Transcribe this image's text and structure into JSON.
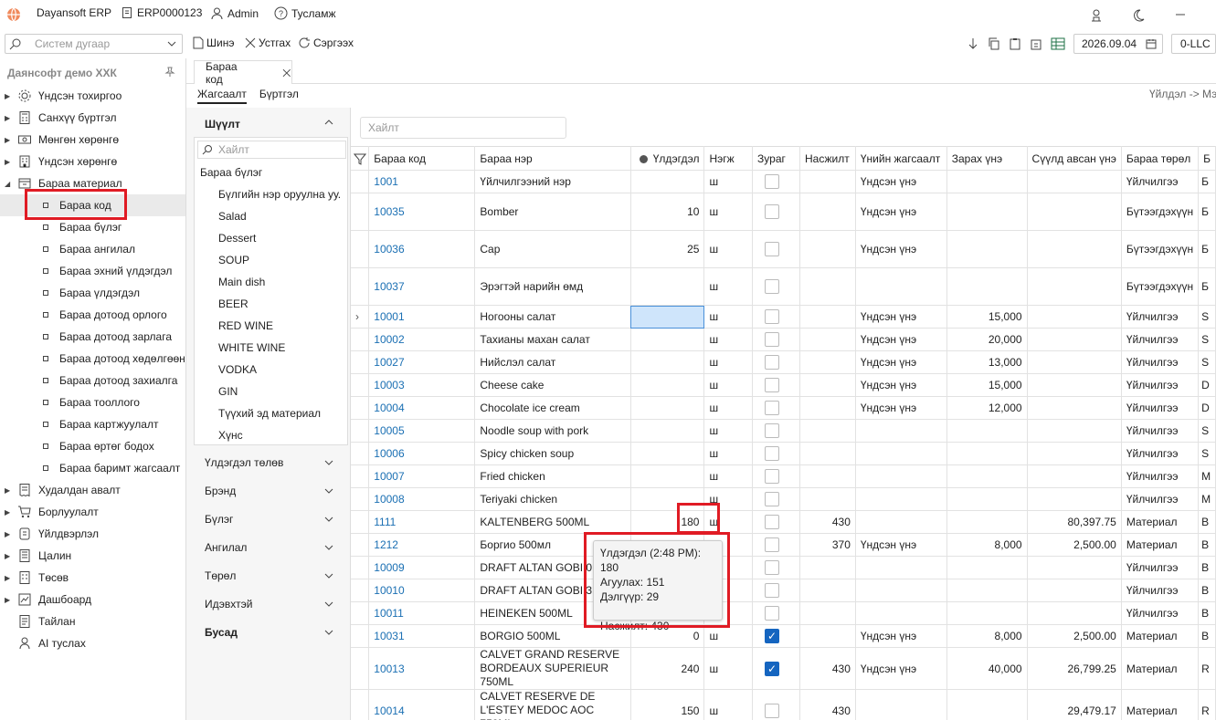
{
  "app": {
    "name": "Dayansoft ERP",
    "erp_code": "ERP0000123",
    "user": "Admin",
    "help": "Тусламж"
  },
  "toolbar": {
    "search_placeholder": "Систем дугаар",
    "new": "Шинэ",
    "delete": "Устгах",
    "refresh": "Сэргээх",
    "date": "2026.09.04",
    "org": "0-LLC"
  },
  "sidebar": {
    "company": "Даянсофт демо ХХК",
    "items": [
      {
        "label": "Үндсэн тохиргоо",
        "icon": "gear-icon"
      },
      {
        "label": "Санхүү бүртгэл",
        "icon": "calculator-icon"
      },
      {
        "label": "Мөнгөн хөрөнгө",
        "icon": "money-icon"
      },
      {
        "label": "Үндсэн хөрөнгө",
        "icon": "building-icon"
      },
      {
        "label": "Бараа материал",
        "icon": "box-icon"
      }
    ],
    "subitems": [
      "Бараа код",
      "Бараа бүлэг",
      "Бараа ангилал",
      "Бараа эхний үлдэгдэл",
      "Бараа үлдэгдэл",
      "Бараа дотоод орлого",
      "Бараа дотоод зарлага",
      "Бараа дотоод хөдөлгөөн",
      "Бараа дотоод захиалга",
      "Бараа тооллого",
      "Бараа картжуулалт",
      "Бараа өртөг бодох",
      "Бараа баримт жагсаалт"
    ],
    "items2": [
      {
        "label": "Худалдан авалт",
        "icon": "receipt-icon"
      },
      {
        "label": "Борлуулалт",
        "icon": "cart-icon"
      },
      {
        "label": "Үйлдвэрлэл",
        "icon": "factory-icon"
      },
      {
        "label": "Цалин",
        "icon": "payroll-icon"
      },
      {
        "label": "Төсөв",
        "icon": "budget-icon"
      },
      {
        "label": "Дашбоард",
        "icon": "dashboard-icon"
      },
      {
        "label": "Тайлан",
        "icon": "report-icon"
      },
      {
        "label": "AI туслах",
        "icon": "ai-assistant-icon"
      }
    ]
  },
  "tab": {
    "label": "Бараа код"
  },
  "subtabs": {
    "list": "Жагсаалт",
    "register": "Бүртгэл"
  },
  "breadcrumb": "Үйлдэл -> Мэ",
  "filter": {
    "title": "Шүүлт",
    "search_placeholder": "Хайлт",
    "group_header": "Бараа бүлэг",
    "groups": [
      "Бүлгийн нэр оруулна уу.",
      "Salad",
      "Dessert",
      "SOUP",
      "Main dish",
      "BEER",
      "RED WINE",
      "WHITE WINE",
      "VODKA",
      "GIN",
      "Түүхий эд материал",
      "Хүнс"
    ],
    "sections": [
      "Үлдэгдэл төлөв",
      "Брэнд",
      "Бүлэг",
      "Ангилал",
      "Төрөл",
      "Идэвхтэй",
      "Бусад"
    ]
  },
  "grid": {
    "search_placeholder": "Хайлт",
    "columns": [
      "Бараа код",
      "Бараа нэр",
      "Үлдэгдэл",
      "Нэгж",
      "Зураг",
      "Насжилт",
      "Үнийн жагсаалт",
      "Зарах үнэ",
      "Сүүлд авсан үнэ",
      "Бараа төрөл",
      "Б"
    ],
    "rows": [
      {
        "code": "1001",
        "name": "Үйлчилгээний нэр",
        "qty": "",
        "unit": "ш",
        "img": false,
        "age": "",
        "price_list": "Үндсэн үнэ",
        "sell": "",
        "last": "",
        "type": "Үйлчилгээ",
        "extra": "Б"
      },
      {
        "code": "10035",
        "name": "Bomber",
        "qty": "10",
        "unit": "ш",
        "img": false,
        "age": "",
        "price_list": "Үндсэн үнэ",
        "sell": "",
        "last": "",
        "type": "Бүтээгдэхүүн",
        "extra": "Б"
      },
      {
        "code": "10036",
        "name": "Cap",
        "qty": "25",
        "unit": "ш",
        "img": false,
        "age": "",
        "price_list": "Үндсэн үнэ",
        "sell": "",
        "last": "",
        "type": "Бүтээгдэхүүн",
        "extra": "Б"
      },
      {
        "code": "10037",
        "name": "Эрэгтэй нарийн өмд",
        "qty": "",
        "unit": "ш",
        "img": false,
        "age": "",
        "price_list": "",
        "sell": "",
        "last": "",
        "type": "Бүтээгдэхүүн",
        "extra": "Б"
      },
      {
        "code": "10001",
        "name": "Ногооны салат",
        "qty": "",
        "unit": "ш",
        "img": false,
        "age": "",
        "price_list": "Үндсэн үнэ",
        "sell": "15,000",
        "last": "",
        "type": "Үйлчилгээ",
        "extra": "S"
      },
      {
        "code": "10002",
        "name": "Тахианы махан салат",
        "qty": "",
        "unit": "ш",
        "img": false,
        "age": "",
        "price_list": "Үндсэн үнэ",
        "sell": "20,000",
        "last": "",
        "type": "Үйлчилгээ",
        "extra": "S"
      },
      {
        "code": "10027",
        "name": "Нийслэл салат",
        "qty": "",
        "unit": "ш",
        "img": false,
        "age": "",
        "price_list": "Үндсэн үнэ",
        "sell": "13,000",
        "last": "",
        "type": "Үйлчилгээ",
        "extra": "S"
      },
      {
        "code": "10003",
        "name": "Cheese cake",
        "qty": "",
        "unit": "ш",
        "img": false,
        "age": "",
        "price_list": "Үндсэн үнэ",
        "sell": "15,000",
        "last": "",
        "type": "Үйлчилгээ",
        "extra": "D"
      },
      {
        "code": "10004",
        "name": "Chocolate ice cream",
        "qty": "",
        "unit": "ш",
        "img": false,
        "age": "",
        "price_list": "Үндсэн үнэ",
        "sell": "12,000",
        "last": "",
        "type": "Үйлчилгээ",
        "extra": "D"
      },
      {
        "code": "10005",
        "name": "Noodle soup with pork",
        "qty": "",
        "unit": "ш",
        "img": false,
        "age": "",
        "price_list": "",
        "sell": "",
        "last": "",
        "type": "Үйлчилгээ",
        "extra": "S"
      },
      {
        "code": "10006",
        "name": "Spicy chicken soup",
        "qty": "",
        "unit": "ш",
        "img": false,
        "age": "",
        "price_list": "",
        "sell": "",
        "last": "",
        "type": "Үйлчилгээ",
        "extra": "S"
      },
      {
        "code": "10007",
        "name": "Fried chicken",
        "qty": "",
        "unit": "ш",
        "img": false,
        "age": "",
        "price_list": "",
        "sell": "",
        "last": "",
        "type": "Үйлчилгээ",
        "extra": "M"
      },
      {
        "code": "10008",
        "name": "Teriyaki chicken",
        "qty": "",
        "unit": "ш",
        "img": false,
        "age": "",
        "price_list": "",
        "sell": "",
        "last": "",
        "type": "Үйлчилгээ",
        "extra": "M"
      },
      {
        "code": "1111",
        "name": "KALTENBERG 500ML",
        "qty": "180",
        "unit": "ш",
        "img": false,
        "age": "430",
        "price_list": "",
        "sell": "",
        "last": "80,397.75",
        "type": "Материал",
        "extra": "B"
      },
      {
        "code": "1212",
        "name": "Боргио 500мл",
        "qty": "",
        "unit": "ш",
        "img": false,
        "age": "370",
        "price_list": "Үндсэн үнэ",
        "sell": "8,000",
        "last": "2,500.00",
        "type": "Материал",
        "extra": "B"
      },
      {
        "code": "10009",
        "name": "DRAFT ALTAN GOBI 0",
        "qty": "",
        "unit": "",
        "img": false,
        "age": "",
        "price_list": "",
        "sell": "",
        "last": "",
        "type": "Үйлчилгээ",
        "extra": "B"
      },
      {
        "code": "10010",
        "name": "DRAFT ALTAN GOBI 3",
        "qty": "",
        "unit": "",
        "img": false,
        "age": "",
        "price_list": "",
        "sell": "",
        "last": "",
        "type": "Үйлчилгээ",
        "extra": "B"
      },
      {
        "code": "10011",
        "name": "HEINEKEN 500ML",
        "qty": "",
        "unit": "",
        "img": false,
        "age": "",
        "price_list": "",
        "sell": "",
        "last": "",
        "type": "Үйлчилгээ",
        "extra": "B"
      },
      {
        "code": "10031",
        "name": "BORGIO 500ML",
        "qty": "0",
        "unit": "ш",
        "img": true,
        "age": "",
        "price_list": "Үндсэн үнэ",
        "sell": "8,000",
        "last": "2,500.00",
        "type": "Материал",
        "extra": "B"
      },
      {
        "code": "10013",
        "name": "CALVET GRAND RESERVE BORDEAUX SUPERIEUR 750ML",
        "qty": "240",
        "unit": "ш",
        "img": true,
        "age": "430",
        "price_list": "Үндсэн үнэ",
        "sell": "40,000",
        "last": "26,799.25",
        "type": "Материал",
        "extra": "R"
      },
      {
        "code": "10014",
        "name": "CALVET RESERVE DE L'ESTEY MEDOC AOC 750ML",
        "qty": "150",
        "unit": "ш",
        "img": false,
        "age": "430",
        "price_list": "",
        "sell": "",
        "last": "29,479.17",
        "type": "Материал",
        "extra": "R"
      }
    ]
  },
  "tooltip": {
    "line1": "Үлдэгдэл (2:48 PM): 180",
    "line2": "Агуулах: 151",
    "line3": "Дэлгүүр: 29",
    "line4": "Насжилт: 430"
  },
  "colors": {
    "link": "#1a6fb3",
    "highlight": "#e01b24",
    "checkbox": "#1565c0"
  }
}
